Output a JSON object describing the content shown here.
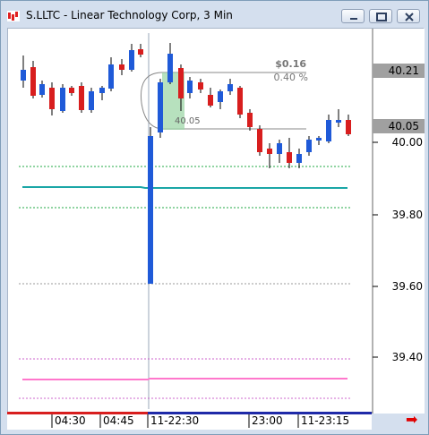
{
  "window": {
    "title": "S.LLTC - Linear Technology Corp, 3 Min",
    "minimize_icon": "minimize-icon",
    "restore_icon": "restore-icon",
    "close_icon": "close-icon"
  },
  "chart": {
    "price_labels": [
      "40.00",
      "39.80",
      "39.60",
      "39.40"
    ],
    "price_badges": [
      "40.21",
      "40.05"
    ],
    "measure": {
      "dollar": "$0.16",
      "percent": "0.40 %",
      "start": "40.05"
    },
    "time_labels": [
      "04:30",
      "04:45",
      "11-22:30",
      "23:00",
      "11-23:15"
    ],
    "colors": {
      "up": "#1f5ad8",
      "down": "#d81e1e",
      "teal": "#1aa6a6",
      "green": "#22aa44",
      "pink": "#ff77cc"
    },
    "next_arrow_icon": "right-arrow-icon"
  }
}
